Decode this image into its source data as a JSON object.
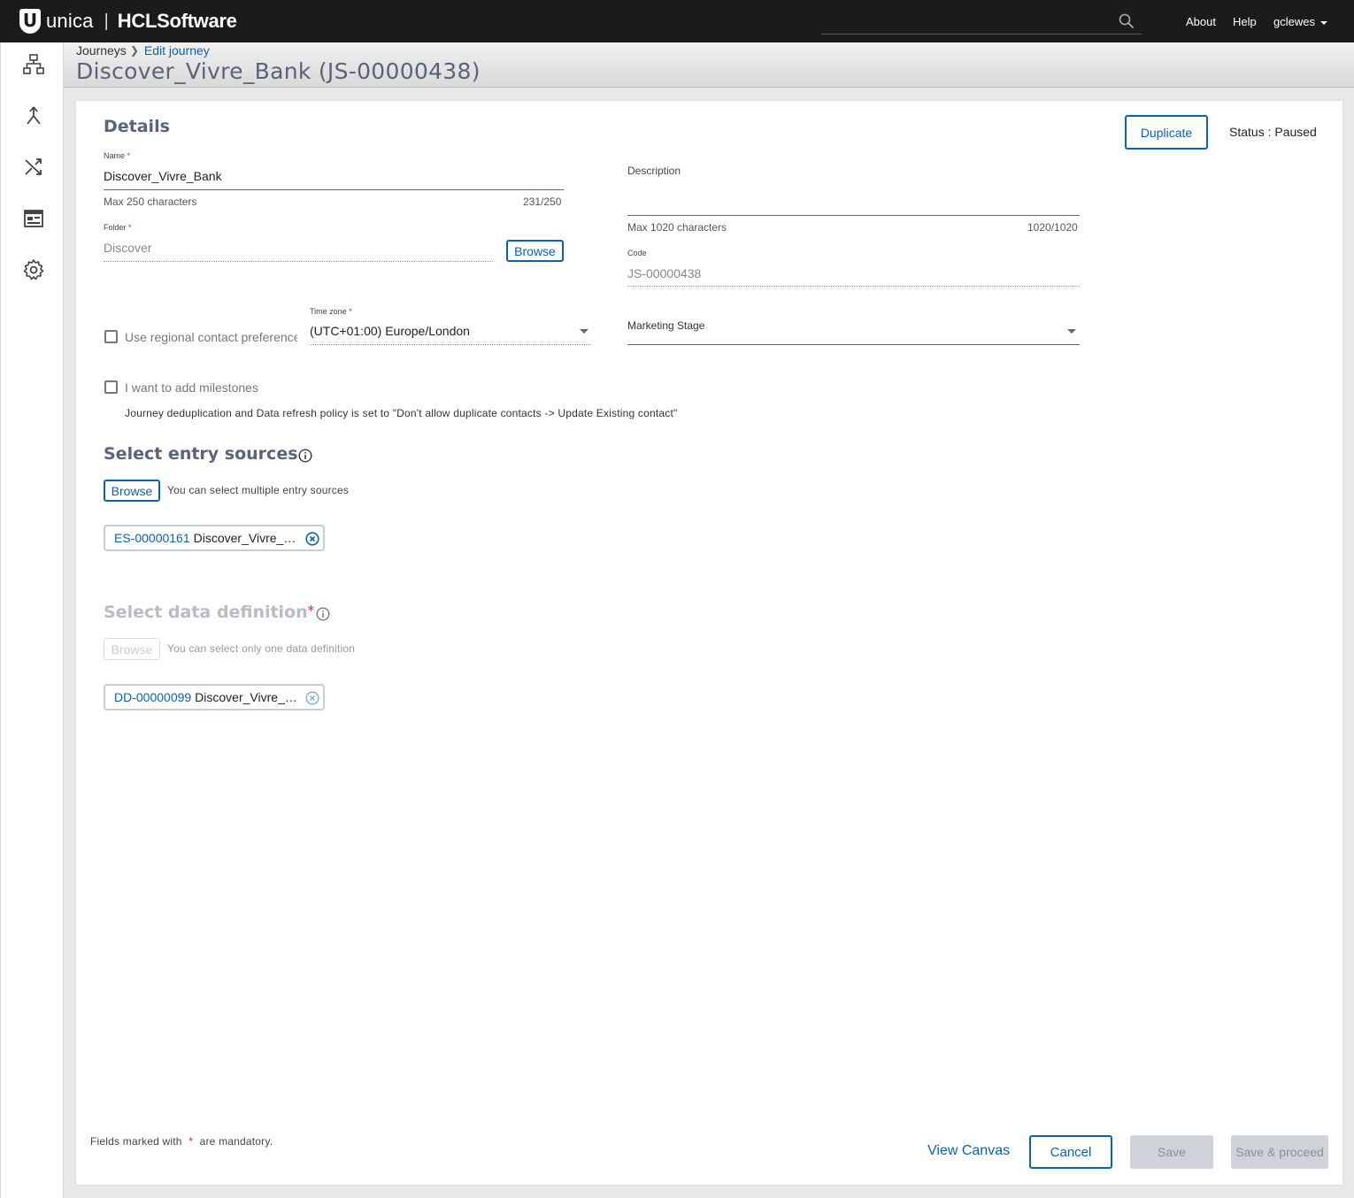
{
  "topbar": {
    "brand_unica": "unica",
    "brand_sep": "|",
    "brand_hcl": "HCLSoftware",
    "search_placeholder": "",
    "about": "About",
    "help": "Help",
    "user": "gclewes"
  },
  "sidebar": {
    "items": [
      {
        "icon": "hierarchy-icon"
      },
      {
        "icon": "merge-arrow-icon"
      },
      {
        "icon": "shuffle-icon"
      },
      {
        "icon": "template-icon"
      },
      {
        "icon": "settings-gear-icon"
      }
    ]
  },
  "breadcrumb": {
    "root": "Journeys",
    "current": "Edit journey"
  },
  "page_title": "Discover_Vivre_Bank (JS-00000438)",
  "details": {
    "title": "Details",
    "duplicate_label": "Duplicate",
    "status": "Status : Paused",
    "name_label": "Name",
    "name_value": "Discover_Vivre_Bank",
    "name_hint": "Max 250 characters",
    "name_count": "231/250",
    "folder_label": "Folder",
    "folder_value": "Discover",
    "folder_browse": "Browse",
    "description_label": "Description",
    "description_value": "",
    "description_hint": "Max 1020 characters",
    "description_count": "1020/1020",
    "code_label": "Code",
    "code_value": "JS-00000438",
    "regional_label": "Use regional contact preference",
    "timezone_label": "Time zone",
    "timezone_value": "(UTC+01:00) Europe/London",
    "marketing_stage_label": "Marketing Stage",
    "marketing_stage_value": "",
    "milestones_label": "I want to add milestones",
    "dedup_note": "Journey deduplication and Data refresh policy is set to \"Don't allow duplicate contacts -> Update Existing contact\""
  },
  "entry_sources": {
    "title": "Select entry sources",
    "browse": "Browse",
    "hint": "You can select multiple entry sources",
    "chips": [
      {
        "code": "ES-00000161",
        "name": "Discover_Vivre_Demo"
      }
    ]
  },
  "data_definition": {
    "title": "Select data definition",
    "required_mark": "*",
    "browse": "Browse",
    "hint": "You can select only one data definition",
    "chips": [
      {
        "code": "DD-00000099",
        "name": "Discover_Vivre_Bank"
      }
    ]
  },
  "footer": {
    "note_prefix": "Fields marked with",
    "note_mark": "*",
    "note_suffix": "are mandatory.",
    "view_canvas": "View Canvas",
    "cancel": "Cancel",
    "save": "Save",
    "save_proceed": "Save & proceed"
  },
  "colors": {
    "accent": "#0a62b0",
    "required": "#d9262a",
    "topbar": "#1b1b1b",
    "title": "#5a6478"
  }
}
